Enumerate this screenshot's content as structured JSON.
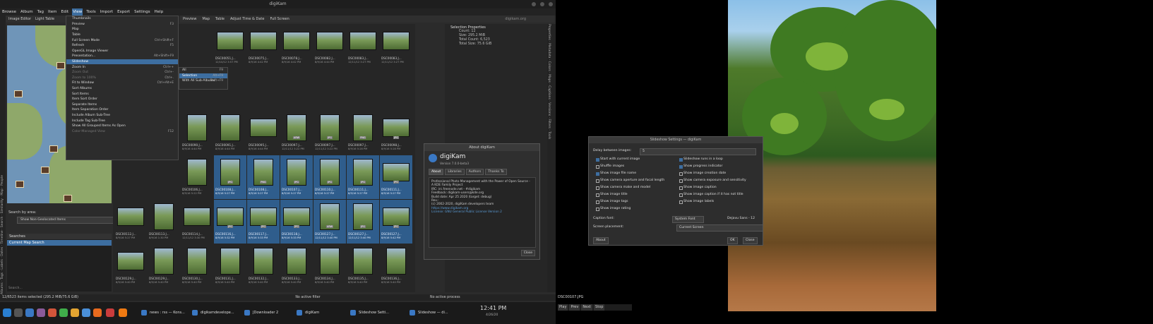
{
  "app": {
    "window_title": "digiKam",
    "menus": [
      "Browse",
      "Album",
      "Tag",
      "Item",
      "Edit",
      "View",
      "Tools",
      "Import",
      "Export",
      "Settings",
      "Help"
    ],
    "left_toolbar": [
      "Image Editor",
      "Light Table"
    ],
    "left_tabs_text": "Albums · Tags · Labels · Dates · Timeline · Search · Similarity · Map · People",
    "main_tabs": [
      "Preview",
      "Map",
      "Table",
      "Adjust Time & Date",
      "Full Screen"
    ],
    "main_tabs_right": "digikam.org",
    "view_menu": [
      {
        "label": "Thumbnails",
        "shortcut": ""
      },
      {
        "label": "Preview",
        "shortcut": "F3"
      },
      {
        "label": "Map",
        "shortcut": ""
      },
      {
        "label": "Table",
        "shortcut": ""
      },
      {
        "label": "Full Screen Mode",
        "shortcut": "Ctrl+Shift+F"
      },
      {
        "label": "Refresh",
        "shortcut": "F5"
      },
      {
        "label": "OpenGL Image Viewer",
        "shortcut": ""
      },
      {
        "label": "Presentation...",
        "shortcut": "Alt+Shift+F9"
      },
      {
        "label": "Slideshow",
        "shortcut": "",
        "selected": true
      },
      {
        "label": "Zoom In",
        "shortcut": "Ctrl++"
      },
      {
        "label": "Zoom Out",
        "shortcut": "Ctrl+-",
        "disabled": true
      },
      {
        "label": "Zoom to 100%",
        "shortcut": "Ctrl+.",
        "disabled": true
      },
      {
        "label": "Fit to Window",
        "shortcut": "Ctrl+Alt+E"
      },
      {
        "label": "Sort Albums",
        "shortcut": ""
      },
      {
        "label": "Sort Items",
        "shortcut": ""
      },
      {
        "label": "Item Sort Order",
        "shortcut": ""
      },
      {
        "label": "Separate Items",
        "shortcut": ""
      },
      {
        "label": "Item Separation Order",
        "shortcut": ""
      },
      {
        "label": "Include Album Sub-Tree",
        "shortcut": ""
      },
      {
        "label": "Include Tag Sub-Tree",
        "shortcut": ""
      },
      {
        "label": "Show All Grouped Items As Open",
        "shortcut": ""
      },
      {
        "label": "Color-Managed View",
        "shortcut": "F12",
        "disabled": true
      }
    ],
    "slideshow_submenu": [
      {
        "label": "All",
        "shortcut": "F9"
      },
      {
        "label": "Selection",
        "shortcut": "Alt+F9",
        "selected": true
      },
      {
        "label": "With All Sub-Albums",
        "shortcut": "Shift+F9"
      }
    ],
    "map_search": {
      "label": "Search by area:",
      "button": "Show Non-Geolocated Items"
    },
    "searches": {
      "header": "Searches",
      "item": "Current Map Search",
      "filter_placeholder": "Search..."
    },
    "thumbnails": [
      {
        "name": "DSC00051.J...",
        "date": "12/10/12 3:57 PM",
        "badge": "",
        "sel": false,
        "land": true
      },
      {
        "name": "DSC00075.J...",
        "date": "8/9/16 4:42 PM",
        "badge": "",
        "sel": false,
        "land": true
      },
      {
        "name": "DSC00078.J...",
        "date": "8/9/16 4:42 PM",
        "badge": "",
        "sel": false,
        "land": true
      },
      {
        "name": "DSC00082.J...",
        "date": "8/9/16 4:44 PM",
        "badge": "",
        "sel": false,
        "land": true
      },
      {
        "name": "DSC00083.J...",
        "date": "12/11/12 3:27 PM",
        "badge": "",
        "sel": false,
        "land": true
      },
      {
        "name": "DSC00083.J...",
        "date": "12/11/12 3:27 PM",
        "badge": "",
        "sel": false,
        "land": true
      },
      {
        "name": "DSC00090.J...",
        "date": "8/9/16 4:44 PM",
        "badge": "",
        "sel": false,
        "land": false
      },
      {
        "name": "DSC00091.J...",
        "date": "8/9/16 4:44 PM",
        "badge": "",
        "sel": false,
        "land": false
      },
      {
        "name": "DSC00095.J...",
        "date": "8/9/16 4:44 PM",
        "badge": "",
        "sel": false,
        "land": true
      },
      {
        "name": "DSC00097.J...",
        "date": "12/11/12 3:22 PM",
        "badge": "ARW",
        "sel": false,
        "land": false
      },
      {
        "name": "DSC00097.J...",
        "date": "12/11/12 3:22 PM",
        "badge": "JPG",
        "sel": false,
        "land": false
      },
      {
        "name": "DSC00097.J...",
        "date": "8/9/16 5:28 PM",
        "badge": "PNG",
        "sel": false,
        "land": false
      },
      {
        "name": "DSC00098.J...",
        "date": "8/9/16 5:28 PM",
        "badge": "JPG",
        "sel": false,
        "land": true
      },
      {
        "name": "DSC00106.J...",
        "date": "8/9/16 5:22 PM",
        "badge": "",
        "sel": false,
        "land": false
      },
      {
        "name": "DSC00108.J...",
        "date": "8/9/16 5:27 PM",
        "badge": "JPG",
        "sel": true,
        "land": false
      },
      {
        "name": "DSC00108.J...",
        "date": "8/9/16 5:27 PM",
        "badge": "PNG",
        "sel": true,
        "land": false
      },
      {
        "name": "DSC00107.J...",
        "date": "8/9/16 5:27 PM",
        "badge": "JPG",
        "sel": true,
        "land": false
      },
      {
        "name": "DSC00110.J...",
        "date": "8/9/16 5:27 PM",
        "badge": "JPG",
        "sel": true,
        "land": false
      },
      {
        "name": "DSC00111.J...",
        "date": "8/9/16 5:27 PM",
        "badge": "JPG",
        "sel": true,
        "land": false
      },
      {
        "name": "DSC00111.J...",
        "date": "8/9/16 5:27 PM",
        "badge": "JPG",
        "sel": true,
        "land": true
      },
      {
        "name": "DSC00112.J...",
        "date": "8/9/16 5:27 PM",
        "badge": "",
        "sel": false,
        "land": true
      },
      {
        "name": "DSC00113.J...",
        "date": "8/9/16 1:30 PM",
        "badge": "",
        "sel": false,
        "land": false
      },
      {
        "name": "DSC00114.J...",
        "date": "12/11/12 3:30 PM",
        "badge": "",
        "sel": false,
        "land": true
      },
      {
        "name": "DSC00116.J...",
        "date": "8/9/16 5:32 PM",
        "badge": "JPG",
        "sel": true,
        "land": true
      },
      {
        "name": "DSC00117.J...",
        "date": "8/9/16 5:33 PM",
        "badge": "JPG",
        "sel": true,
        "land": true
      },
      {
        "name": "DSC00118.J...",
        "date": "8/9/16 5:33 PM",
        "badge": "JPG",
        "sel": true,
        "land": true
      },
      {
        "name": "DSC00127.J...",
        "date": "12/11/12 3:40 PM",
        "badge": "ARW",
        "sel": true,
        "land": false
      },
      {
        "name": "DSC00127.J...",
        "date": "12/11/12 3:40 PM",
        "badge": "JPG",
        "sel": true,
        "land": false
      },
      {
        "name": "DSC00127.J...",
        "date": "8/9/16 5:42 PM",
        "badge": "JPG",
        "sel": true,
        "land": true
      },
      {
        "name": "DSC00129.J...",
        "date": "8/9/16 5:40 PM",
        "badge": "",
        "sel": false,
        "land": true
      },
      {
        "name": "DSC00129.J...",
        "date": "8/9/16 5:40 PM",
        "badge": "",
        "sel": false,
        "land": false
      },
      {
        "name": "DSC00130.J...",
        "date": "8/9/16 5:40 PM",
        "badge": "",
        "sel": false,
        "land": false
      },
      {
        "name": "DSC00131.J...",
        "date": "8/9/16 5:40 PM",
        "badge": "",
        "sel": false,
        "land": false
      },
      {
        "name": "DSC00132.J...",
        "date": "8/9/16 5:40 PM",
        "badge": "",
        "sel": false,
        "land": false
      },
      {
        "name": "DSC00133.J...",
        "date": "8/9/16 5:40 PM",
        "badge": "",
        "sel": false,
        "land": false
      },
      {
        "name": "DSC00134.J...",
        "date": "8/9/16 5:40 PM",
        "badge": "",
        "sel": false,
        "land": false
      },
      {
        "name": "DSC00135.J...",
        "date": "8/9/16 5:40 PM",
        "badge": "",
        "sel": false,
        "land": false
      },
      {
        "name": "DSC00136.J...",
        "date": "8/9/16 5:40 PM",
        "badge": "",
        "sel": false,
        "land": false
      }
    ],
    "selection_properties": {
      "header": "Selection Properties",
      "rows": [
        "Count: 12",
        "Size: 295.2 MiB",
        "Total Count: 6,523",
        "Total Size: 75.6 GiB"
      ]
    },
    "right_tabs_text": "Properties · Metadata · Colors · Maps · Captions · Versions · Filters · Tools",
    "about": {
      "title": "About digiKam",
      "app_name": "digiKam",
      "version": "Version 7.0.0-beta3",
      "tabs": [
        "About",
        "Libraries",
        "Authors",
        "Thanks To"
      ],
      "lines": [
        "Professional Photo Management with the Power of Open Source - A KDE Family Project",
        "IRC: irc.freenode.net - #digikam",
        "Feedback: digikam-users@kde.org",
        "Build date: Apr 25 2020 (target: debug)",
        "Rev.:",
        "(c) 2002-2020, digiKam developers team"
      ],
      "links": [
        "https://www.digikam.org",
        "License: GNU General Public License Version 2"
      ],
      "close": "Close"
    },
    "status": {
      "left": "12/6523 items selected (295.2 MiB/75.6 GiB)",
      "middle": "No active filter",
      "right": "No active process"
    },
    "taskbar": {
      "tasks": [
        "news : rss — Kons...",
        "digikamdevelope...",
        "JDownloader 2",
        "digiKam",
        "Slideshow Setti...",
        "Slideshow — di..."
      ],
      "clock": "12:41 PM",
      "date": "4/26/20"
    }
  },
  "slideshow": {
    "filename": "DSC00107.JPG",
    "controls": [
      "Play",
      "Prev",
      "Next",
      "Stop"
    ],
    "dialog": {
      "title": "Slideshow Settings — digiKam",
      "delay_label": "Delay between images:",
      "delay_value": "5",
      "left_options": [
        {
          "label": "Start with current image",
          "on": true
        },
        {
          "label": "Shuffle images",
          "on": false
        },
        {
          "label": "Show image file name",
          "on": true
        },
        {
          "label": "Show camera aperture and focal length",
          "on": false
        },
        {
          "label": "Show camera make and model",
          "on": false
        },
        {
          "label": "Show image title",
          "on": false
        },
        {
          "label": "Show image tags",
          "on": false
        },
        {
          "label": "Show image rating",
          "on": false
        }
      ],
      "right_options": [
        {
          "label": "Slideshow runs in a loop",
          "on": true
        },
        {
          "label": "Show progress indicator",
          "on": true
        },
        {
          "label": "Show image creation date",
          "on": false
        },
        {
          "label": "Show camera exposure and sensitivity",
          "on": false
        },
        {
          "label": "Show image caption",
          "on": false
        },
        {
          "label": "Show image caption if it has not title",
          "on": false
        },
        {
          "label": "Show image labels",
          "on": false
        }
      ],
      "caption_font_label": "Caption font:",
      "caption_font_value": "System Font",
      "caption_font_sample": "Dejavu Sans - 12",
      "screen_label": "Screen placement:",
      "screen_value": "Current Screen",
      "about_btn": "About",
      "ok_btn": "OK",
      "close_btn": "Close"
    }
  }
}
